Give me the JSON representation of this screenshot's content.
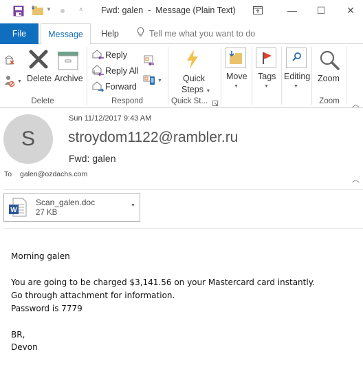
{
  "window": {
    "title": "Fwd: galen  -  Message (Plain Text)",
    "controls": {
      "restore_ribbon_icon": "ribbon-display-options-icon",
      "minimize": "—",
      "maximize": "☐",
      "close": "✕"
    }
  },
  "quick_access": {
    "save_icon": "save-icon",
    "move_icon": "move-to-folder-icon",
    "customize_icon": "customize-qat-icon"
  },
  "tabs": {
    "file": "File",
    "message": "Message",
    "help": "Help",
    "tell_me": "Tell me what you want to do"
  },
  "ribbon": {
    "delete_group": {
      "label": "Delete",
      "ignore_icon": "ignore-conversation-icon",
      "junk_icon": "block-sender-icon",
      "delete": "Delete",
      "archive": "Archive"
    },
    "respond_group": {
      "label": "Respond",
      "reply": "Reply",
      "reply_all": "Reply All",
      "forward": "Forward"
    },
    "quick_steps_group": {
      "label": "Quick St...",
      "quick_steps_line1": "Quick",
      "quick_steps_line2": "Steps"
    },
    "move": "Move",
    "tags": "Tags",
    "editing": "Editing",
    "zoom_group": {
      "label": "Zoom",
      "zoom": "Zoom"
    }
  },
  "message": {
    "avatar_initial": "S",
    "date": "Sun 11/12/2017 9:43 AM",
    "from": "stroydom1122@rambler.ru",
    "subject": "Fwd: galen",
    "to_label": "To",
    "to": "galen@ozdachs.com",
    "attachment": {
      "name": "Scan_galen.doc",
      "size": "27 KB"
    },
    "body": [
      "Morning galen",
      "",
      "You are going to be charged $3,141.56 on your Mastercard card instantly.",
      "Go through attachment for information.",
      "Password is 7779",
      "",
      "BR,",
      "Devon"
    ]
  },
  "colors": {
    "file_tab": "#106ebe",
    "active_tab_text": "#1a6fc0",
    "avatar_bg": "#d4d4d4"
  }
}
